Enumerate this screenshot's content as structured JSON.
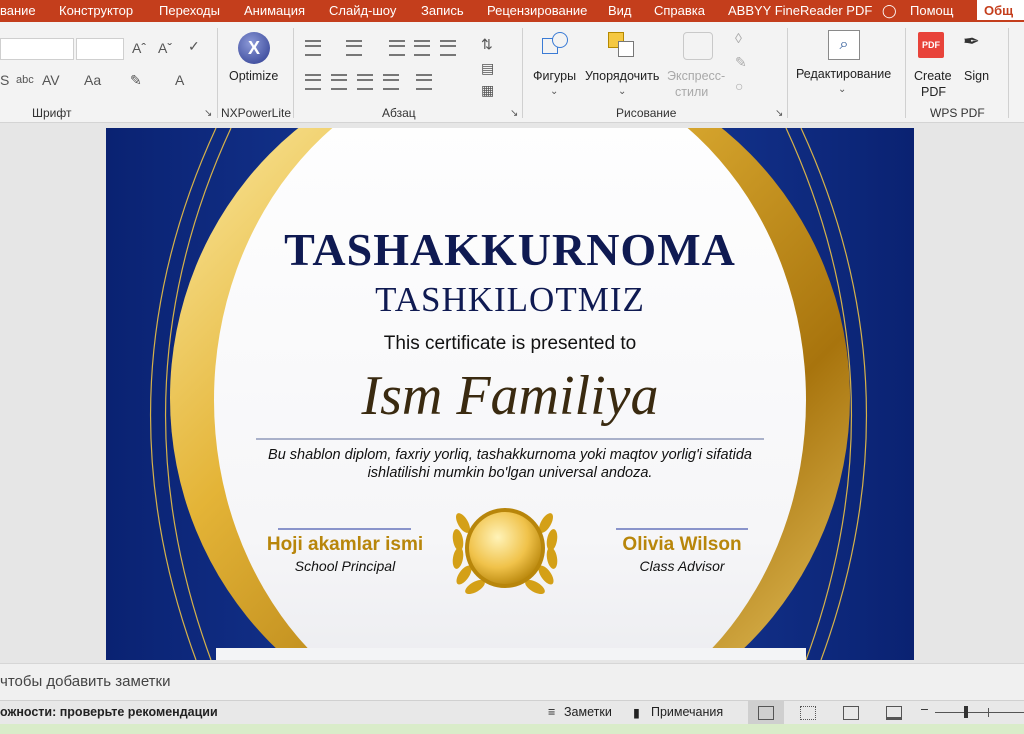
{
  "tabs": [
    "вание",
    "Конструктор",
    "Переходы",
    "Анимация",
    "Слайд-шоу",
    "Запись",
    "Рецензирование",
    "Вид",
    "Справка",
    "ABBYY FineReader PDF"
  ],
  "tab_help_search": "Помощ",
  "tab_share": "Общ",
  "ribbon": {
    "font_group": "Шрифт",
    "nxpower_group": "NXPowerLite",
    "optimize": "Optimize",
    "paragraph_group": "Абзац",
    "drawing_group": "Рисование",
    "shapes": "Фигуры",
    "arrange": "Упорядочить",
    "quick_styles_1": "Экспресс-",
    "quick_styles_2": "стили",
    "editing": "Редактирование",
    "create_pdf_1": "Create",
    "create_pdf_2": "PDF",
    "sign": "Sign",
    "wps_group": "WPS PDF"
  },
  "slide": {
    "title": "TASHAKKURNOMA",
    "org": "TASHKILOTMIZ",
    "presented": "This certificate is presented to",
    "recipient": "Ism Familiya",
    "desc_1": "Bu shablon diplom, faxriy yorliq, tashakkurnoma yoki maqtov yorlig'i sifatida",
    "desc_2": "ishlatilishi mumkin bo'lgan universal andoza.",
    "sig_left_name": "Hoji akamlar ismi",
    "sig_left_role": "School Principal",
    "sig_right_name": "Olivia Wilson",
    "sig_right_role": "Class Advisor"
  },
  "notes_placeholder": "чтобы добавить заметки",
  "status": {
    "accessibility": "ожности: проверьте рекомендации",
    "notes": "Заметки",
    "comments": "Примечания"
  },
  "colors": {
    "accent": "#c43e1c",
    "navy": "#0e2a7a",
    "gold": "#d4a017"
  }
}
